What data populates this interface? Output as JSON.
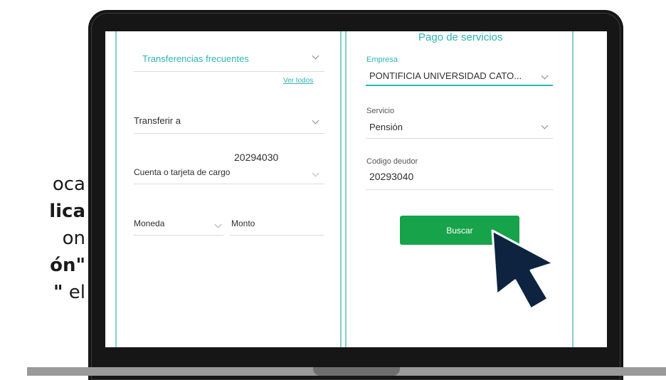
{
  "side_text": {
    "line1": "oca",
    "line2": "lica",
    "line3": "on",
    "line4": "ón\"",
    "line5_bold": "\"",
    "line5_rest": " el"
  },
  "transfer_panel": {
    "frequent": {
      "value": "Transferencias frecuentes",
      "link": "Ver todos"
    },
    "transfer_to": {
      "value": "Transferir a"
    },
    "account": {
      "number": "20294030",
      "label": "Cuenta o tarjeta de cargo"
    },
    "currency": {
      "label": "Moneda"
    },
    "amount": {
      "label": "Monto"
    }
  },
  "services_panel": {
    "title": "Pago de servicios",
    "company": {
      "label": "Empresa",
      "value": "PONTIFICIA UNIVERSIDAD CATO..."
    },
    "service": {
      "label": "Servicio",
      "value": "Pensión"
    },
    "debtor_code": {
      "label": "Codigo deudor",
      "value": "20293040"
    },
    "search_button": "Buscar"
  },
  "colors": {
    "accent_teal": "#2fb4b4",
    "button_green": "#17a34a",
    "cursor_navy": "#0d2340",
    "laptop_frame": "#161616"
  }
}
